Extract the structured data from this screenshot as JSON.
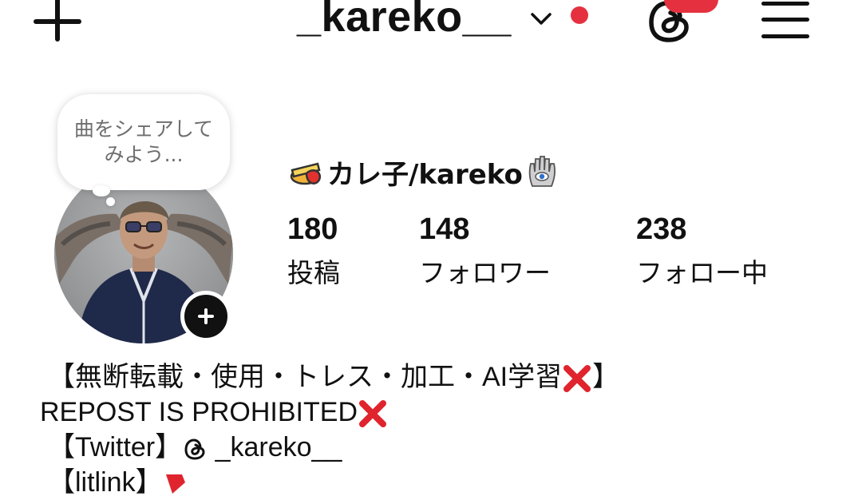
{
  "header": {
    "username": "_kareko__"
  },
  "note": {
    "text": "曲をシェアしてみよう..."
  },
  "profile": {
    "display_name": "カレ子/kareko"
  },
  "stats": [
    {
      "value": "180",
      "label": "投稿"
    },
    {
      "value": "148",
      "label": "フォロワー"
    },
    {
      "value": "238",
      "label": "フォロー中"
    }
  ],
  "bio": {
    "line1": "【無断転載・使用・トレス・加工・AI学習",
    "line1_end": "】",
    "line2": "REPOST IS PROHIBITED",
    "line3_a": "【Twitter】",
    "line3_b": "_kareko__",
    "line4": "【litlink】"
  },
  "colors": {
    "accent_red": "#e5313f",
    "cross_red": "#e0242e",
    "text": "#111111"
  },
  "icons": [
    "plus-icon",
    "chevron-down-icon",
    "threads-icon",
    "menu-icon",
    "add-icon",
    "threads-small-icon",
    "cross-mark-icon",
    "link-icon"
  ]
}
